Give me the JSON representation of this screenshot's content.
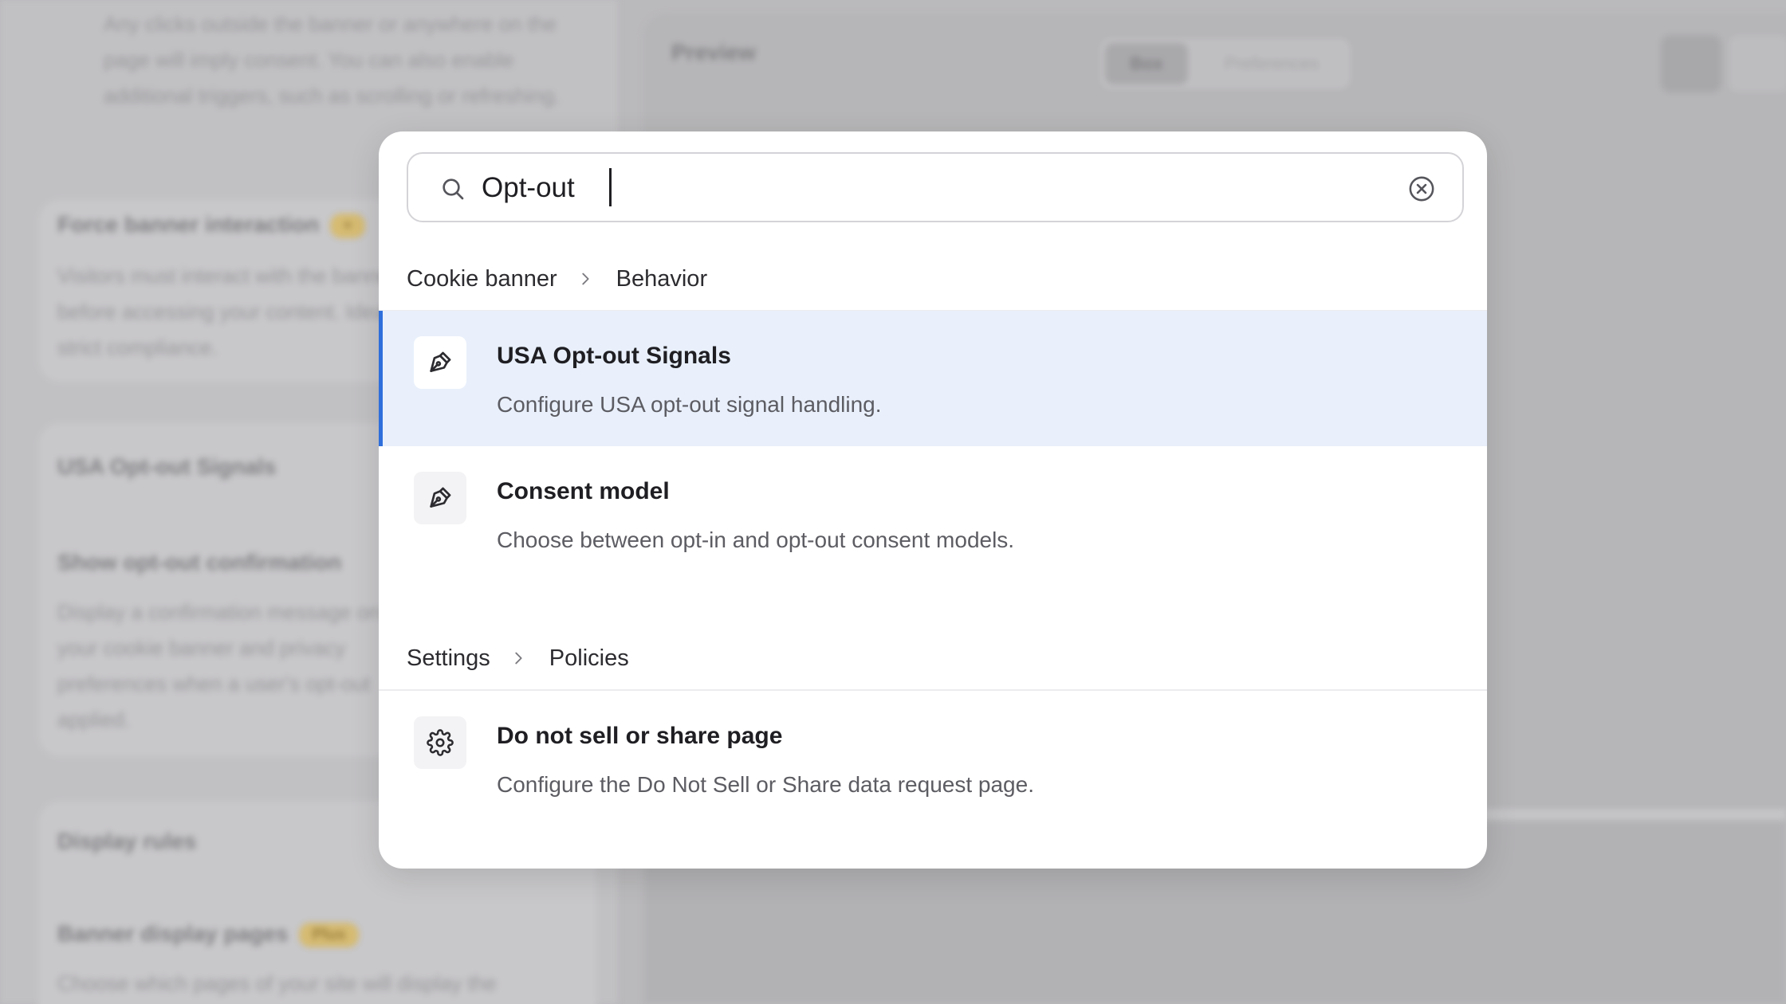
{
  "search": {
    "value": "Opt-out",
    "placeholder": ""
  },
  "groups": [
    {
      "breadcrumb": [
        "Cookie banner",
        "Behavior"
      ],
      "results": [
        {
          "title": "USA Opt-out Signals",
          "description": "Configure USA opt-out signal handling.",
          "icon": "pen-nib-icon",
          "active": true
        },
        {
          "title": "Consent model",
          "description": "Choose between opt-in and opt-out consent models.",
          "icon": "pen-nib-icon",
          "active": false
        }
      ]
    },
    {
      "breadcrumb": [
        "Settings",
        "Policies"
      ],
      "results": [
        {
          "title": "Do not sell or share page",
          "description": "Configure the Do Not Sell or Share data request page.",
          "icon": "gear-icon",
          "active": false
        }
      ]
    }
  ],
  "background": {
    "left_text_1": "Any clicks outside the banner or anywhere on the page will imply consent. You can also enable additional triggers, such as scrolling or refreshing.",
    "heading_force": "Force banner interaction",
    "badge_force": "+",
    "left_text_2": "Visitors must interact with the banner before accessing your content. Ideal for strict compliance.",
    "heading_usa": "USA Opt-out Signals",
    "heading_show": "Show opt-out confirmation",
    "left_text_3": "Display a confirmation message on your cookie banner and privacy preferences when a user's opt-out applied.",
    "heading_display": "Display rules",
    "heading_pages": "Banner display pages",
    "badge_pages": "Plus",
    "left_text_4": "Choose which pages of your site will display the",
    "preview_title": "Preview",
    "toggle_on": "Box",
    "toggle_off": "Preferences"
  },
  "colors": {
    "accent": "#2f6fdc",
    "active_bg": "#e9f0fb",
    "badge": "#e4c46a"
  }
}
